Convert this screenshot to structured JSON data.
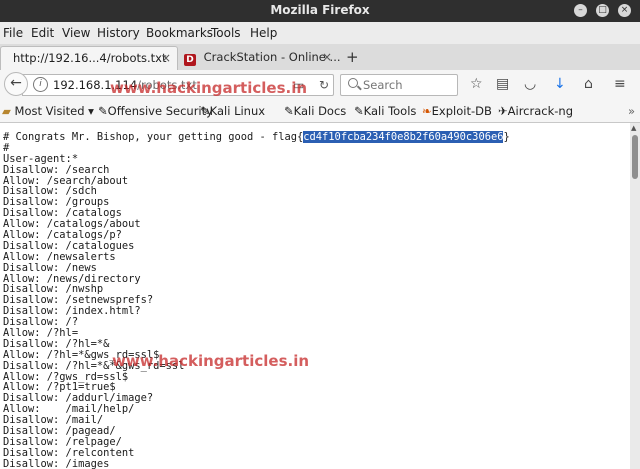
{
  "window": {
    "title": "Mozilla Firefox"
  },
  "menu": [
    "File",
    "Edit",
    "View",
    "History",
    "Bookmarks",
    "Tools",
    "Help"
  ],
  "tabs": {
    "active_label": "http://192.16...4/robots.txt",
    "inactive_label": "CrackStation - Online ...",
    "inactive_favicon": "D",
    "close_glyph": "×",
    "new_tab_glyph": "+"
  },
  "nav": {
    "url_host": "192.168.1.114",
    "url_path": "/robots.txt",
    "search_placeholder": "Search"
  },
  "bookmarks": [
    "Most Visited ▾",
    "Offensive Security",
    "Kali Linux",
    "Kali Docs",
    "Kali Tools",
    "Exploit-DB",
    "Aircrack-ng"
  ],
  "page": {
    "first_line_prefix": "# Congrats Mr. Bishop, your getting good - flag{",
    "flag_value": "cd4f10fcba234f0e8b2f60a490c306e6",
    "first_line_suffix": "}",
    "lines": [
      "#",
      "User-agent:*",
      "Disallow: /search",
      "Allow: /search/about",
      "Disallow: /sdch",
      "Disallow: /groups",
      "Disallow: /catalogs",
      "Allow: /catalogs/about",
      "Allow: /catalogs/p?",
      "Disallow: /catalogues",
      "Allow: /newsalerts",
      "Disallow: /news",
      "Allow: /news/directory",
      "Disallow: /nwshp",
      "Disallow: /setnewsprefs?",
      "Disallow: /index.html?",
      "Disallow: /?",
      "Allow: /?hl=",
      "Disallow: /?hl=*&",
      "Allow: /?hl=*&gws_rd=ssl$",
      "Disallow: /?hl=*&*&gws_rd=ssl",
      "Allow: /?gws_rd=ssl$",
      "Allow: /?pt1=true$",
      "Disallow: /addurl/image?",
      "Allow:    /mail/help/",
      "Disallow: /mail/",
      "Disallow: /pagead/",
      "Disallow: /relpage/",
      "Disallow: /relcontent",
      "Disallow: /images"
    ]
  },
  "watermarks": {
    "top": "www.hackingarticles.in",
    "middle": "www.hackingarticles.in"
  },
  "colors": {
    "titlebar": "#2f2f2f",
    "selection": "#2b5fb3",
    "watermark": "#c62828",
    "download_arrow": "#1a73e8"
  }
}
